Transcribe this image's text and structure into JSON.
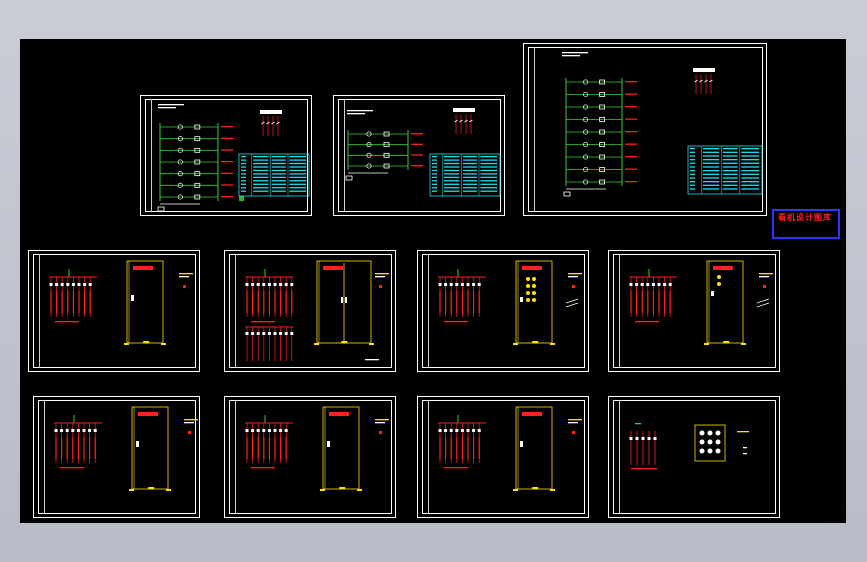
{
  "app": {
    "background_top": "#c9cdd6",
    "canvas_background": "#000000"
  },
  "colors": {
    "sheet_border": "#ffffff",
    "bus_green": "#35d035",
    "component_white": "#ffffff",
    "text_red": "#ff2020",
    "table_cyan": "#1ee0f0",
    "cabinet_yellow": "#ffe100",
    "legend_border": "#2a36ff"
  },
  "legend": {
    "title": "看机设计图库",
    "line1": "",
    "line2": ""
  },
  "sheets": [
    {
      "id": "sheet-1",
      "kind": "schematic",
      "has_table": true
    },
    {
      "id": "sheet-2",
      "kind": "schematic",
      "has_table": true
    },
    {
      "id": "sheet-3",
      "kind": "schematic",
      "has_table": true
    },
    {
      "id": "sheet-4",
      "kind": "cabinet",
      "variant": "single-door"
    },
    {
      "id": "sheet-5",
      "kind": "cabinet",
      "variant": "double-door"
    },
    {
      "id": "sheet-6",
      "kind": "cabinet",
      "variant": "meters"
    },
    {
      "id": "sheet-7",
      "kind": "cabinet",
      "variant": "single-door"
    },
    {
      "id": "sheet-8",
      "kind": "cabinet",
      "variant": "single-door"
    },
    {
      "id": "sheet-9",
      "kind": "cabinet",
      "variant": "single-door"
    },
    {
      "id": "sheet-10",
      "kind": "cabinet",
      "variant": "single-door"
    },
    {
      "id": "sheet-11",
      "kind": "panel",
      "variant": "meter-panel"
    }
  ]
}
